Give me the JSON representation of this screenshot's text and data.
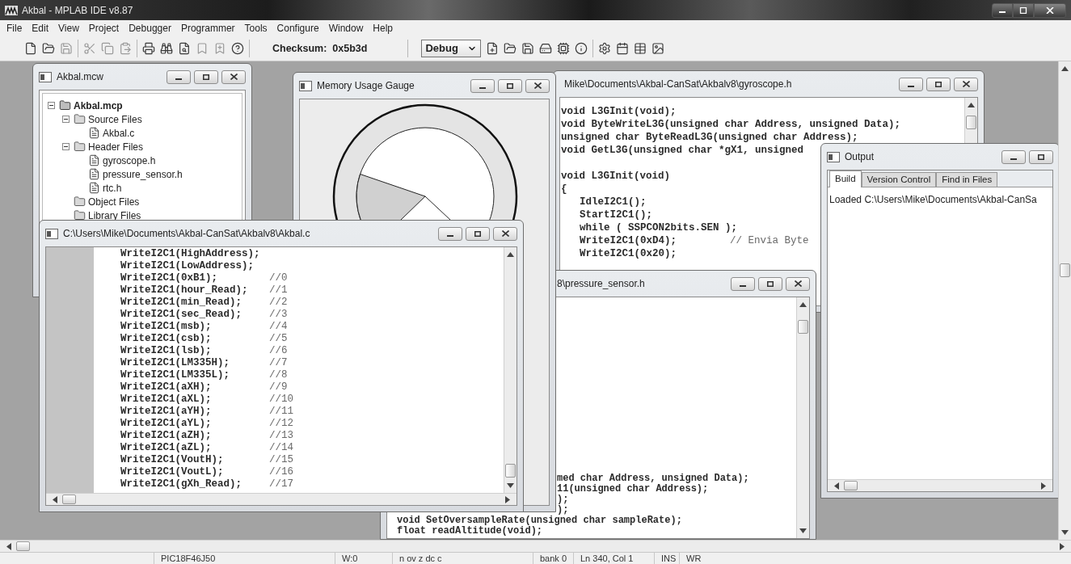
{
  "app_title": "Akbal - MPLAB IDE v8.87",
  "menu": [
    "File",
    "Edit",
    "View",
    "Project",
    "Debugger",
    "Programmer",
    "Tools",
    "Configure",
    "Window",
    "Help"
  ],
  "toolbar": {
    "checksum": "Checksum:  0x5b3d",
    "build_config": "Debug"
  },
  "windows": [
    {
      "kind": "project",
      "title": "Akbal.mcw",
      "tree": [
        {
          "label": "Akbal.mcp",
          "kind": "project",
          "expanded": true,
          "children": [
            {
              "label": "Source Files",
              "kind": "folder",
              "expanded": true,
              "children": [
                {
                  "label": "Akbal.c",
                  "kind": "file"
                }
              ]
            },
            {
              "label": "Header Files",
              "kind": "folder",
              "expanded": true,
              "children": [
                {
                  "label": "gyroscope.h",
                  "kind": "file"
                },
                {
                  "label": "pressure_sensor.h",
                  "kind": "file"
                },
                {
                  "label": "rtc.h",
                  "kind": "file"
                }
              ]
            },
            {
              "label": "Object Files",
              "kind": "folder"
            },
            {
              "label": "Library Files",
              "kind": "folder"
            }
          ]
        }
      ]
    },
    {
      "kind": "gauge",
      "title": "Memory Usage Gauge"
    },
    {
      "kind": "editor",
      "title": "Mike\\Documents\\Akbal-CanSat\\Akbalv8\\gyroscope.h",
      "lines": [
        {
          "kind": "decl",
          "code": "void L3GInit(void);"
        },
        {
          "kind": "decl",
          "code": "void ByteWriteL3G(unsigned char Address, unsigned Data);"
        },
        {
          "kind": "decl",
          "code": "unsigned char ByteReadL3G(unsigned char Address);"
        },
        {
          "kind": "decl",
          "code": "void GetL3G(unsigned char *gX1, unsigned"
        },
        {
          "kind": "spaced",
          "code": "void L3GInit(void)"
        },
        {
          "kind": "decl",
          "code": "{"
        },
        {
          "kind": "body",
          "code": "IdleI2C1();"
        },
        {
          "kind": "body",
          "code": "StartI2C1();"
        },
        {
          "kind": "body",
          "code": "while ( SSPCON2bits.SEN );"
        },
        {
          "kind": "body",
          "code": "WriteI2C1(0xD4);",
          "comment": "// Envia Byte"
        },
        {
          "kind": "body",
          "code": "WriteI2C1(0x20);"
        }
      ]
    },
    {
      "kind": "output",
      "title": "Output",
      "tabs": [
        {
          "label": "Build",
          "selected": true
        },
        {
          "label": "Version Control",
          "selected": false
        },
        {
          "label": "Find in Files",
          "selected": false
        }
      ],
      "text": "Loaded C:\\Users\\Mike\\Documents\\Akbal-CanSa"
    },
    {
      "kind": "editor",
      "title": "C:\\Users\\Mike\\Documents\\Akbal-CanSat\\Akbalv8\\Akbal.c",
      "lines": [
        {
          "kind": "body",
          "code": "WriteI2C1(HighAddress);"
        },
        {
          "kind": "body",
          "code": "WriteI2C1(LowAddress);"
        },
        {
          "kind": "body",
          "code": "WriteI2C1(0xB1);",
          "comment": "//0"
        },
        {
          "kind": "body",
          "code": "WriteI2C1(hour_Read);",
          "comment": "//1"
        },
        {
          "kind": "body",
          "code": "WriteI2C1(min_Read);",
          "comment": "//2"
        },
        {
          "kind": "body",
          "code": "WriteI2C1(sec_Read);",
          "comment": "//3"
        },
        {
          "kind": "body",
          "code": "WriteI2C1(msb);",
          "comment": "//4"
        },
        {
          "kind": "body",
          "code": "WriteI2C1(csb);",
          "comment": "//5"
        },
        {
          "kind": "body",
          "code": "WriteI2C1(lsb);",
          "comment": "//6"
        },
        {
          "kind": "body",
          "code": "WriteI2C1(LM335H);",
          "comment": "//7"
        },
        {
          "kind": "body",
          "code": "WriteI2C1(LM335L);",
          "comment": "//8"
        },
        {
          "kind": "body",
          "code": "WriteI2C1(aXH);",
          "comment": "//9"
        },
        {
          "kind": "body",
          "code": "WriteI2C1(aXL);",
          "comment": "//10"
        },
        {
          "kind": "body",
          "code": "WriteI2C1(aYH);",
          "comment": "//11"
        },
        {
          "kind": "body",
          "code": "WriteI2C1(aYL);",
          "comment": "//12"
        },
        {
          "kind": "body",
          "code": "WriteI2C1(aZH);",
          "comment": "//13"
        },
        {
          "kind": "body",
          "code": "WriteI2C1(aZL);",
          "comment": "//14"
        },
        {
          "kind": "body",
          "code": "WriteI2C1(VoutH);",
          "comment": "//15"
        },
        {
          "kind": "body",
          "code": "WriteI2C1(VoutL);",
          "comment": "//16"
        },
        {
          "kind": "body",
          "code": "WriteI2C1(gXh_Read);",
          "comment": "//17"
        }
      ]
    },
    {
      "kind": "editor",
      "title": "8\\pressure_sensor.h",
      "lines": [
        {
          "kind": "covered",
          "code": "med char Address, unsigned Data);"
        },
        {
          "kind": "covered",
          "code": "11(unsigned char Address);"
        },
        {
          "kind": "covered",
          "code": ");"
        },
        {
          "kind": "covered",
          "code": ");"
        },
        {
          "kind": "decl",
          "code": "void SetOversampleRate(unsigned char sampleRate);"
        },
        {
          "kind": "decl",
          "code": "float readAltitude(void);"
        }
      ]
    }
  ],
  "status_bar": [
    "PIC18F46J50",
    "W:0",
    "n ov z dc c",
    "bank 0",
    "Ln 340, Col 1",
    "INS",
    "WR"
  ]
}
